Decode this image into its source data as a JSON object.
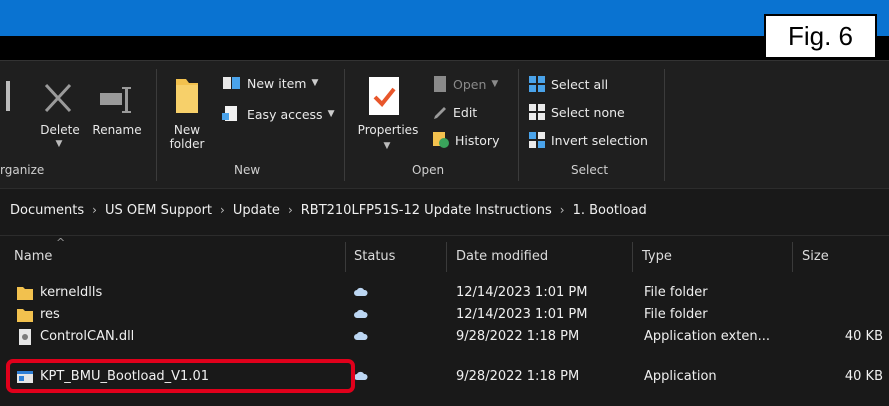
{
  "figure_label": "Fig. 6",
  "ribbon": {
    "organize": {
      "label": "rganize",
      "delete_label": "Delete",
      "rename_label": "Rename"
    },
    "new": {
      "label": "New",
      "new_folder_label_line1": "New",
      "new_folder_label_line2": "folder",
      "new_item_label": "New item",
      "easy_access_label": "Easy access"
    },
    "open": {
      "label": "Open",
      "properties_label": "Properties",
      "open_label": "Open",
      "edit_label": "Edit",
      "history_label": "History"
    },
    "select": {
      "label": "Select",
      "select_all_label": "Select all",
      "select_none_label": "Select none",
      "invert_label": "Invert selection"
    }
  },
  "address_bar": {
    "crumbs": [
      "Documents",
      "US OEM Support",
      "Update",
      "RBT210LFP51S-12 Update Instructions",
      "1. Bootload"
    ]
  },
  "columns": {
    "name": "Name",
    "status": "Status",
    "date": "Date modified",
    "type": "Type",
    "size": "Size"
  },
  "files": [
    {
      "name": "kerneldlls",
      "date": "12/14/2023 1:01 PM",
      "type": "File folder",
      "size": "",
      "icon": "folder-icon"
    },
    {
      "name": "res",
      "date": "12/14/2023 1:01 PM",
      "type": "File folder",
      "size": "",
      "icon": "folder-icon"
    },
    {
      "name": "ControlCAN.dll",
      "date": "9/28/2022 1:18 PM",
      "type": "Application exten...",
      "size": "40 KB",
      "icon": "dll-file-icon"
    },
    {
      "name": "KPT_BMU_Bootload_V1.01",
      "date": "9/28/2022 1:18 PM",
      "type": "Application",
      "size": "40 KB",
      "icon": "application-icon"
    }
  ],
  "colors": {
    "title_bar": "#0a73d1",
    "background": "#191919",
    "highlight": "#e0001b",
    "folder": "#f2c14e",
    "cloud": "#bcd6f2"
  }
}
